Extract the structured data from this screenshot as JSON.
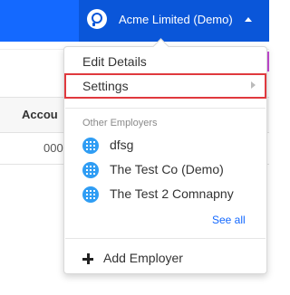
{
  "header": {
    "employer_name": "Acme Limited (Demo)"
  },
  "background": {
    "column_header": "Accou",
    "cell_value": "000"
  },
  "dropdown": {
    "items": [
      {
        "label": "Edit Details"
      },
      {
        "label": "Settings"
      }
    ],
    "section_title": "Other Employers",
    "employers": [
      {
        "name": "dfsg"
      },
      {
        "name": "The Test Co (Demo)"
      },
      {
        "name": "The Test 2 Comnapny"
      }
    ],
    "see_all_label": "See all",
    "add_employer_label": "Add Employer"
  },
  "colors": {
    "topbar": "#1469ff",
    "employer_switch": "#0a56d9",
    "highlight_border": "#e0393e",
    "employer_icon": "#2f9df4",
    "link": "#1469ff"
  },
  "icons": {
    "logo": "logo-icon",
    "caret": "caret-up-icon",
    "submenu": "chevron-right-icon",
    "employer": "building-icon",
    "add": "plus-icon"
  }
}
